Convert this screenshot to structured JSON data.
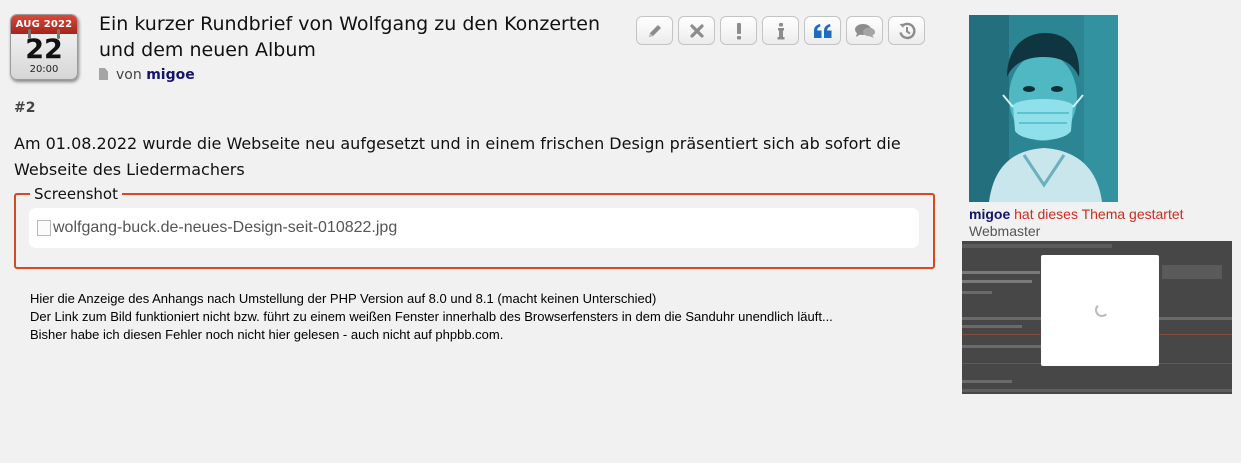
{
  "calendar": {
    "month_year": "AUG 2022",
    "day": "22",
    "time": "20:00"
  },
  "post": {
    "title": "Ein kurzer Rundbrief von Wolfgang zu den Konzerten und dem neuen Album",
    "by_label": "von",
    "author": "migoe",
    "number": "#2",
    "text": "Am 01.08.2022 wurde die Webseite neu aufgesetzt und in einem frischen Design präsentiert sich ab sofort die Webseite des Liedermachers",
    "attachment_legend": "Screenshot",
    "attachment_alt": "wolfgang-buck.de-neues-Design-seit-010822.jpg"
  },
  "toolbar": {
    "icons": [
      "pencil-icon",
      "close-icon",
      "exclamation-icon",
      "info-icon",
      "quote-icon",
      "comments-icon",
      "history-icon"
    ]
  },
  "note_lines": [
    "Hier die Anzeige des Anhangs nach Umstellung der PHP Version auf 8.0 und 8.1 (macht keinen Unterschied)",
    "Der Link zum Bild funktioniert nicht bzw. führt zu einem weißen Fenster innerhalb des Browserfensters in dem die Sanduhr unendlich läuft...",
    "Bisher habe ich diesen Fehler noch nicht hier gelesen - auch nicht auf phpbb.com."
  ],
  "sidebar": {
    "username": "migoe",
    "started_text": "hat dieses Thema gestartet",
    "role": "Webmaster"
  },
  "colors": {
    "accent_border": "#d9491b",
    "author_color": "#14146e",
    "starter_red": "#d42a1a",
    "calendar_red": "#b8342a",
    "quote_blue": "#1e6bc0"
  }
}
